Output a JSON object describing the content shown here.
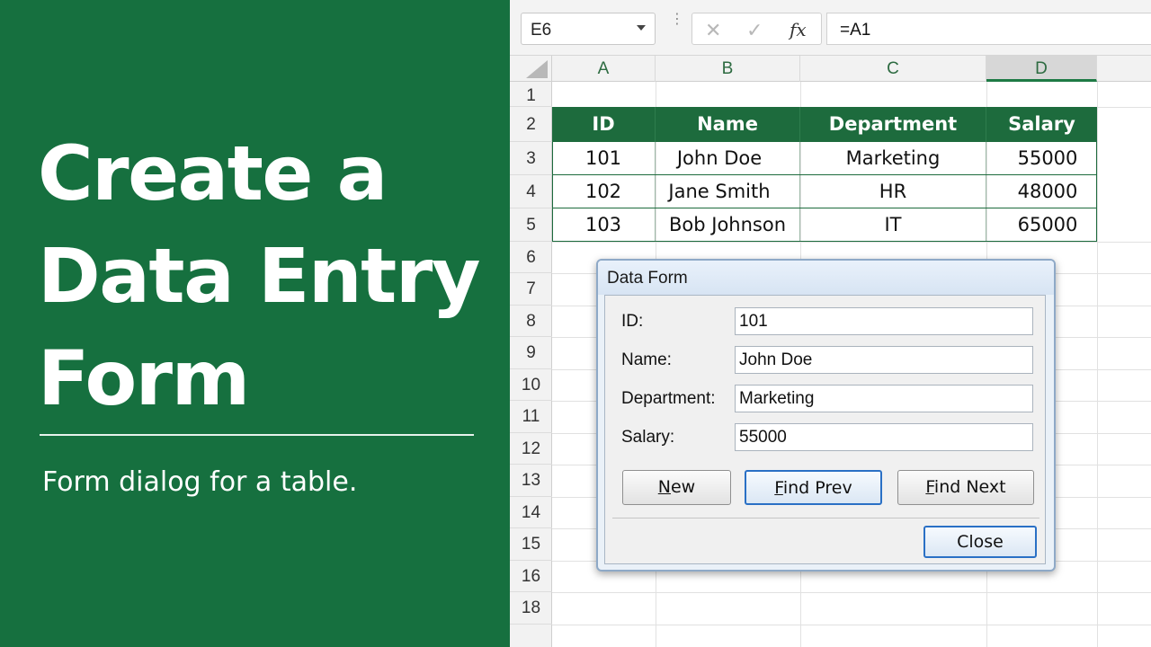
{
  "promo": {
    "headline_lines": [
      "Create a",
      "Data Entry",
      "Form"
    ],
    "subtitle": "Form dialog for a table."
  },
  "formula_bar": {
    "name_box": "E6",
    "cancel_glyph": "✕",
    "enter_glyph": "✓",
    "fx_glyph": "fx",
    "formula": "=A1"
  },
  "columns": [
    "A",
    "B",
    "C",
    "D"
  ],
  "selected_column": "D",
  "rows": [
    "1",
    "2",
    "3",
    "4",
    "5",
    "6",
    "7",
    "8",
    "9",
    "10",
    "11",
    "12",
    "13",
    "14",
    "15",
    "16",
    "18"
  ],
  "table": {
    "headers": [
      "ID",
      "Name",
      "Department",
      "Salary"
    ],
    "rows": [
      [
        "101",
        "John Doe",
        "Marketing",
        "55000"
      ],
      [
        "102",
        "Jane Smith",
        "HR",
        "48000"
      ],
      [
        "103",
        "Bob Johnson",
        "IT",
        "65000"
      ]
    ]
  },
  "dialog": {
    "title": "Data Form",
    "fields": [
      {
        "label": "ID:",
        "value": "101"
      },
      {
        "label": "Name:",
        "value": "John Doe"
      },
      {
        "label": "Department:",
        "value": "Marketing"
      },
      {
        "label": "Salary:",
        "value": "55000"
      }
    ],
    "buttons": {
      "new_mn": "N",
      "new_rest": "ew",
      "find_prev_mn": "F",
      "find_prev_rest": "ind Prev",
      "find_next_mn": "F",
      "find_next_rest": "ind Next",
      "close": "Close"
    }
  },
  "colors": {
    "brand_green": "#16703f",
    "table_header": "#1d6b3d",
    "focus_blue": "#2a70c5"
  }
}
